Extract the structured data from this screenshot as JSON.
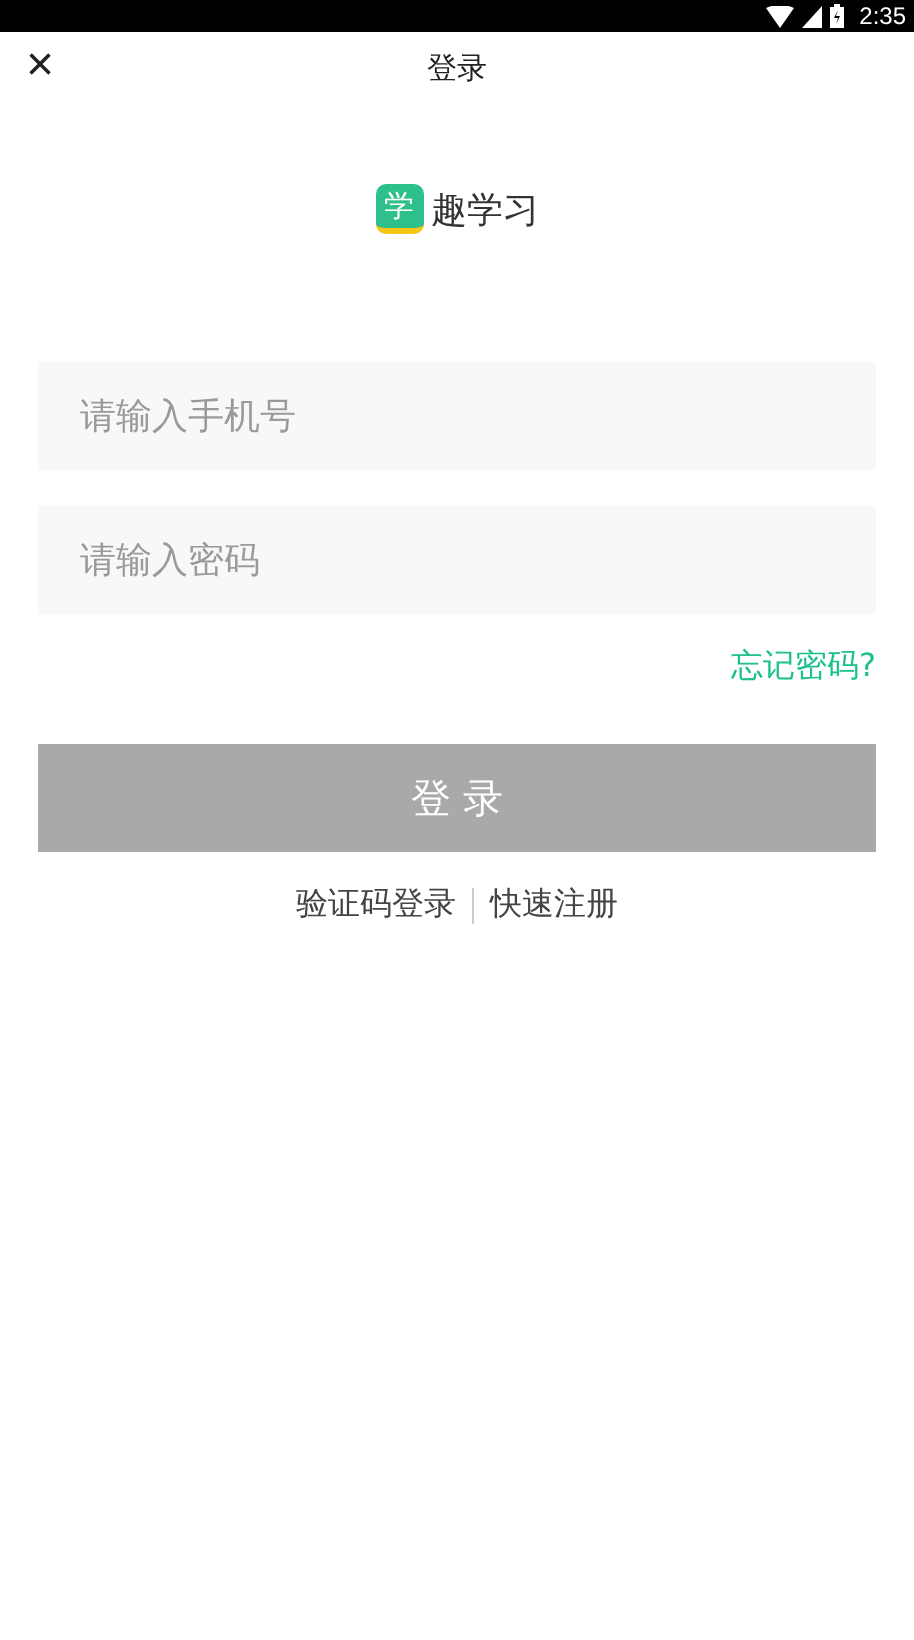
{
  "status_bar": {
    "time": "2:35"
  },
  "header": {
    "close": "×",
    "title": "登录"
  },
  "logo": {
    "mark": "学",
    "name": "趣学习"
  },
  "fields": [
    {
      "placeholder": "请输入手机号"
    },
    {
      "placeholder": "请输入密码"
    }
  ],
  "forgot_link": "忘记密码?",
  "login_button": {
    "label": "登 录",
    "disabled": true
  },
  "links": [
    "验证码登录",
    "快速注册"
  ]
}
